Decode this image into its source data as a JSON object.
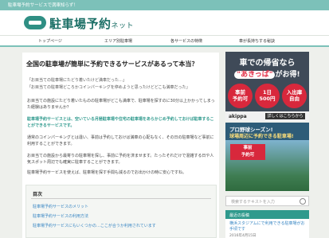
{
  "topbar": {
    "text": "駐車場予約サービスで満車知らず！"
  },
  "header": {
    "logo_main": "駐車場予約",
    "logo_sub": "ネット"
  },
  "nav": {
    "items": [
      "トップページ",
      "エリア別駐車場",
      "各サービスの特徴",
      "車が長持ちする秘訣"
    ]
  },
  "article": {
    "title": "全国の駐車場が簡単に予約できるサービスがあるって本当？",
    "quotes": [
      "「お目当ての駐車場にたどり着いたけど満車だった…」",
      "「お目当ての駐車場どころかコインパーキングを停めようと思ったけどどこも満車だった」"
    ],
    "p1": "お目当ての施設にたどり着いたものの駐車場がどこも満車で、駐車場を探すのに30分以上かかってしまった経験はありませんか？",
    "p2": "駐車場予約サービスとは、空いている月極駐車場や住宅の駐車場をあらかじめ予約しておけば駐車することができるサービスです。",
    "p3": "通常のコインパーキングとは違い、事前は予約しておけば満車の心配もなく、その日の駐車場など事前に利用することができます。",
    "p4": "お目当ての施設から最寄りの駐車場を探し、事前に予約を済ませます。たったそれだけで混雑する日や人気スポット周辺でも確実に駐車することができます。",
    "p5": "駐車場予約サービスを使えば、駐車場を探す手間も減るのでお出かけの時に安心ですね。"
  },
  "toc": {
    "title": "目次",
    "items": [
      "駐車場予約サービスのメリット",
      "駐車場予約サービスの利用方法",
      "駐車場予約サービスにもいくつかの…ここが合うか利用されています"
    ]
  },
  "ad1": {
    "headline1": "車での帰省なら",
    "headline2_pre": "",
    "headline2_em": "\"あきっぱ\"",
    "headline2_post": "がお得!",
    "circles": [
      "事前\n予約可",
      "1日\n500円",
      "入出庫\n自由"
    ],
    "brand": "akippa",
    "cta": "詳しくはこちらから"
  },
  "ad2": {
    "line1": "プロ野球シーズン!",
    "line2": "球場周辺に予約できる駐車場!",
    "box": "事前\n予約可"
  },
  "search": {
    "placeholder": "検索するテキストを入力"
  },
  "recent": {
    "heading": "最近の投稿",
    "item": "横浜スタジアムにで利用できる駐車場がお手頃です",
    "date": "2016年4月15日"
  },
  "colors": {
    "accent": "#7cc1b9",
    "brand": "#2f9a8d",
    "ad_red": "#d8283c"
  }
}
